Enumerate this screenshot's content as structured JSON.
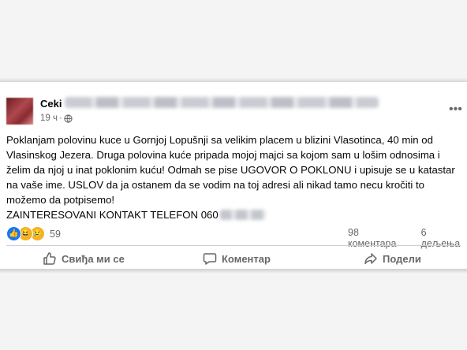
{
  "post": {
    "author": "Ceki",
    "time": "19 ч",
    "privacy_icon": "globe-icon",
    "menu_icon": "more-icon",
    "text_lines": [
      "Poklanjam polovinu kuce u Gornjoj Lopušnji sa velikim placem u blizini Vlasotinca, 40 min od",
      "Vlasinskog Jezera. Druga polovina kuće pripada mojoj majci sa kojom sam u lošim odnosima i",
      "želim da njoj u inat poklonim kuću! Odmah se pise UGOVOR O POKLONU i upisuje se u katastar",
      "na vaše ime. USLOV da ja ostanem da se vodim na toj adresi ali nikad tamo necu kročiti to",
      "možemo da potpisemo!"
    ],
    "contact_line": "ZAINTERESOVANI KONTAKT TELEFON 060"
  },
  "reactions": {
    "icons": [
      "like-icon",
      "haha-icon",
      "sad-icon"
    ],
    "count": "59"
  },
  "stats": {
    "comments": "98 коментара",
    "shares": "6 дељења"
  },
  "actions": {
    "like": "Свиђа ми се",
    "comment": "Коментар",
    "share": "Подели"
  },
  "colors": {
    "background": "#f4f4f4",
    "card": "#ffffff",
    "text": "#050505",
    "secondary_text": "#65676b",
    "like_blue": "#1877f2",
    "emoji_yellow": "#f7b125"
  }
}
